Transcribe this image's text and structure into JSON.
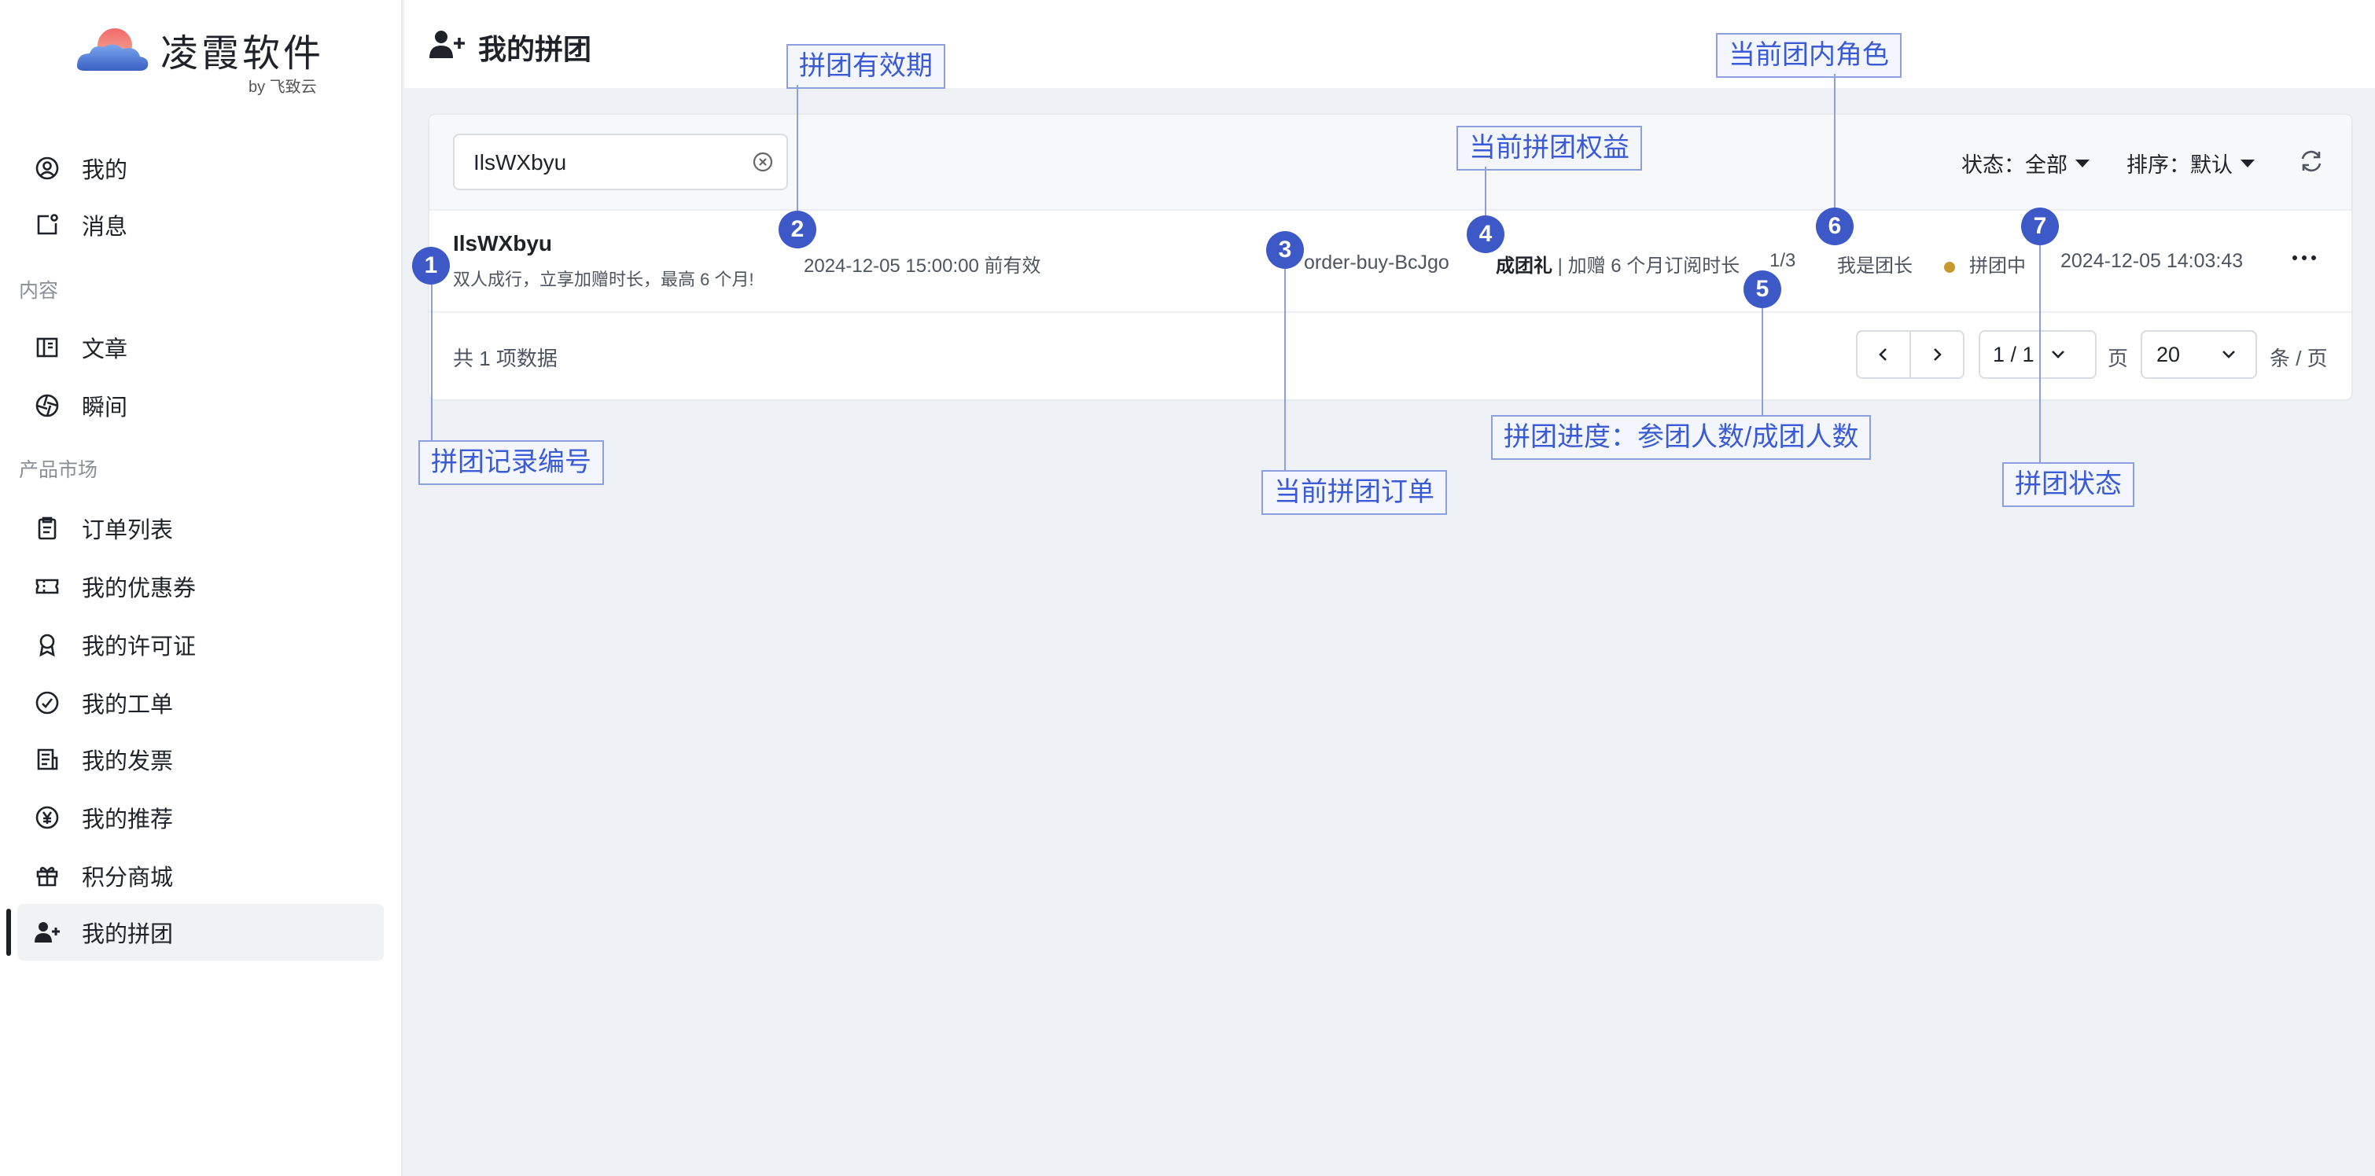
{
  "brand": {
    "name": "凌霞软件",
    "by": "by 飞致云"
  },
  "sidebar": {
    "items_top": [
      {
        "label": "我的",
        "icon": "user-circle-icon"
      },
      {
        "label": "消息",
        "icon": "message-icon"
      }
    ],
    "section_content": "内容",
    "items_content": [
      {
        "label": "文章",
        "icon": "article-icon"
      },
      {
        "label": "瞬间",
        "icon": "moment-icon"
      }
    ],
    "section_market": "产品市场",
    "items_market": [
      {
        "label": "订单列表",
        "icon": "clipboard-icon"
      },
      {
        "label": "我的优惠券",
        "icon": "ticket-icon"
      },
      {
        "label": "我的许可证",
        "icon": "award-icon"
      },
      {
        "label": "我的工单",
        "icon": "check-circle-icon"
      },
      {
        "label": "我的发票",
        "icon": "invoice-icon"
      },
      {
        "label": "我的推荐",
        "icon": "yen-icon"
      },
      {
        "label": "积分商城",
        "icon": "gift-icon"
      },
      {
        "label": "我的拼团",
        "icon": "user-plus-icon",
        "active": true
      }
    ]
  },
  "header": {
    "title": "我的拼团"
  },
  "toolbar": {
    "search_value": "IlsWXbyu",
    "status_label": "状态：全部",
    "sort_label": "排序：默认"
  },
  "row": {
    "id": "IlsWXbyu",
    "desc": "双人成行，立享加赠时长，最高 6 个月!",
    "validity": "2024-12-05 15:00:00 前有效",
    "order": "order-buy-BcJgo",
    "benefit_title": "成团礼",
    "benefit_desc": " | 加赠 6 个月订阅时长",
    "progress": "1/3",
    "role": "我是团长",
    "status": "拼团中",
    "time": "2024-12-05 14:03:43"
  },
  "pagination": {
    "total": "共 1 项数据",
    "page": "1 / 1",
    "page_unit": "页",
    "size": "20",
    "size_unit": "条 / 页"
  },
  "annotations": [
    {
      "num": "1",
      "text": "拼团记录编号"
    },
    {
      "num": "2",
      "text": "拼团有效期"
    },
    {
      "num": "3",
      "text": "当前拼团订单"
    },
    {
      "num": "4",
      "text": "当前拼团权益"
    },
    {
      "num": "5",
      "text": "拼团进度：参团人数/成团人数"
    },
    {
      "num": "6",
      "text": "当前团内角色"
    },
    {
      "num": "7",
      "text": "拼团状态"
    }
  ],
  "colors": {
    "accent": "#3d59c8",
    "status_dot": "#c79a2c"
  }
}
